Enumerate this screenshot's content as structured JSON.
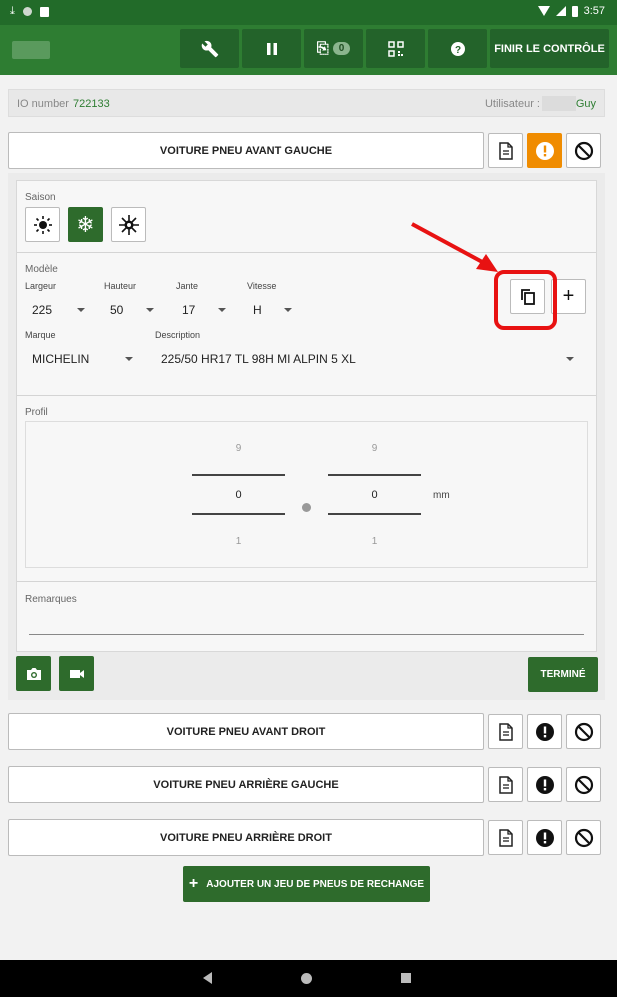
{
  "status_bar": {
    "time": "3:57"
  },
  "toolbar": {
    "attachments_count": "0",
    "finish_label": "FINIR LE CONTRÔLE"
  },
  "info": {
    "io_label": "IO number",
    "io_value": "722133",
    "user_label": "Utilisateur :",
    "user_value": "Guy"
  },
  "tires": {
    "front_left": "VOITURE PNEU AVANT GAUCHE",
    "front_right": "VOITURE PNEU AVANT DROIT",
    "rear_left": "VOITURE PNEU ARRIÈRE GAUCHE",
    "rear_right": "VOITURE PNEU ARRIÈRE DROIT"
  },
  "detail": {
    "season_title": "Saison",
    "model_title": "Modèle",
    "labels": {
      "width": "Largeur",
      "height": "Hauteur",
      "rim": "Jante",
      "speed": "Vitesse",
      "brand": "Marque",
      "description": "Description"
    },
    "values": {
      "width": "225",
      "height": "50",
      "rim": "17",
      "speed": "H",
      "brand": "MICHELIN",
      "description": "225/50 HR17 TL 98H  MI ALPIN 5 XL"
    },
    "profile_title": "Profil",
    "profile": {
      "left": {
        "max": "9",
        "value": "0",
        "min": "1"
      },
      "right": {
        "max": "9",
        "value": "0",
        "min": "1"
      },
      "unit": "mm"
    },
    "remarks_title": "Remarques",
    "done_label": "TERMINÉ"
  },
  "add_spare_label": "AJOUTER UN JEU DE PNEUS DE RECHANGE"
}
